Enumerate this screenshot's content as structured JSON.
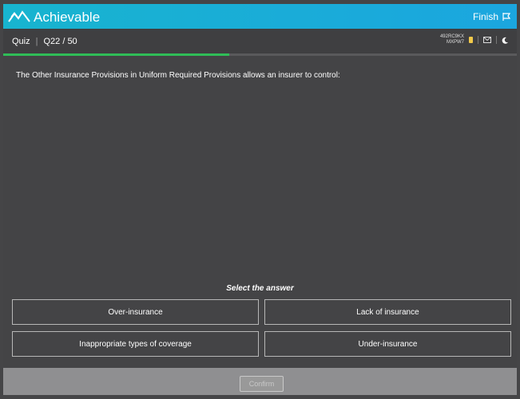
{
  "app": {
    "title": "Achievable",
    "finish_label": "Finish"
  },
  "breadcrumb": {
    "section": "Quiz",
    "position": "Q22 / 50"
  },
  "tools": {
    "code_line1": "492RC9KX",
    "code_line2": "MXPW7"
  },
  "progress": {
    "fraction": 0.44
  },
  "question": {
    "text": "The Other Insurance Provisions in Uniform Required Provisions allows an insurer to control:"
  },
  "prompt": "Select the answer",
  "answers": [
    "Over-insurance",
    "Lack of insurance",
    "Inappropriate types of coverage",
    "Under-insurance"
  ],
  "confirm_label": "Confirm",
  "colors": {
    "brand": "#1ba6df",
    "progress": "#2fbd57",
    "panel": "#444446"
  }
}
